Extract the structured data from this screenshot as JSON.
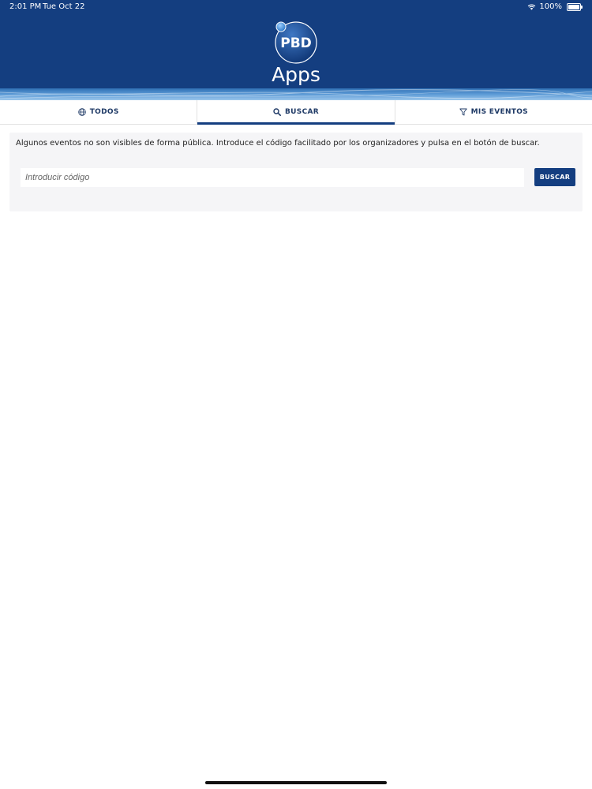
{
  "status_bar": {
    "time": "2:01 PM",
    "date": "Tue Oct 22",
    "battery": "100%"
  },
  "header": {
    "logo_text": "PBD",
    "app_title": "Apps",
    "colors": {
      "background": "#143e80",
      "accent": "#5d9bd6"
    }
  },
  "tabs": [
    {
      "label": "TODOS",
      "icon": "globe-icon",
      "active": false
    },
    {
      "label": "BUSCAR",
      "icon": "search-icon",
      "active": true
    },
    {
      "label": "MIS EVENTOS",
      "icon": "filter-icon",
      "active": false
    }
  ],
  "search_panel": {
    "info": "Algunos eventos no son visibles de forma pública. Introduce el código facilitado por los organizadores y pulsa en el botón de buscar.",
    "input_placeholder": "Introducir código",
    "input_value": "",
    "button_label": "BUSCAR"
  }
}
